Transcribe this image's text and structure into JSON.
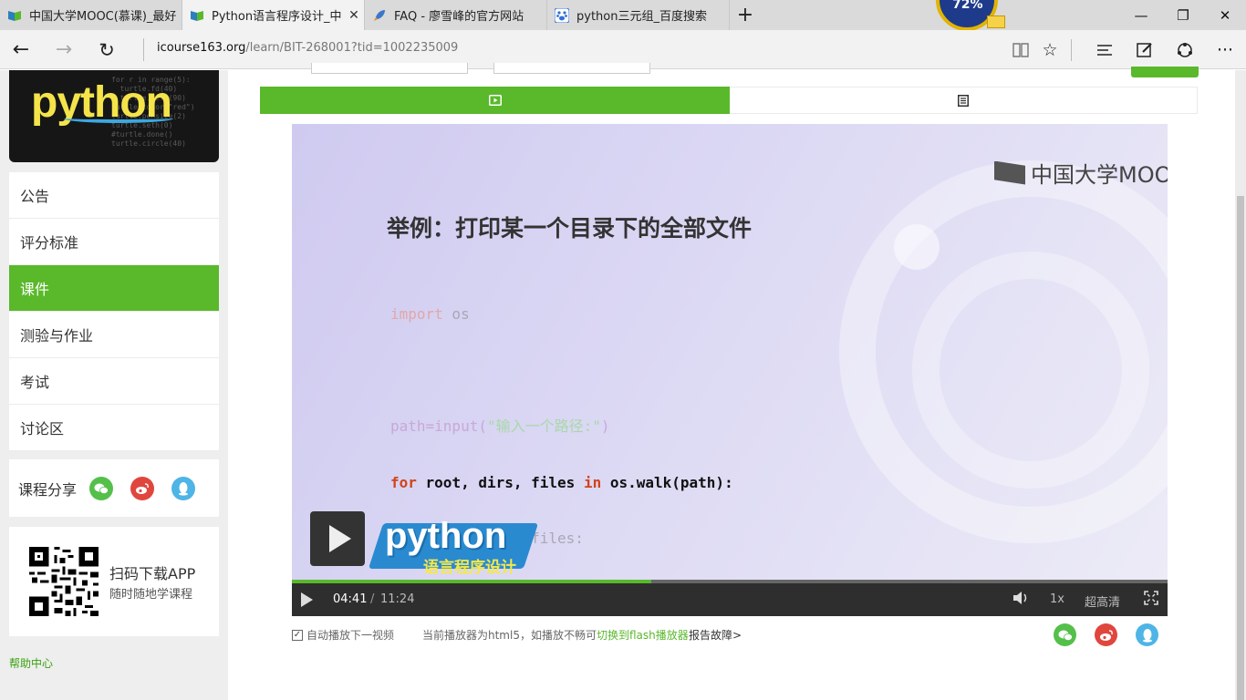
{
  "browser": {
    "tabs": [
      {
        "title": "中国大学MOOC(慕课)_最好",
        "active": false,
        "icon": "mooc-book-icon"
      },
      {
        "title": "Python语言程序设计_中",
        "active": true,
        "icon": "mooc-book-icon"
      },
      {
        "title": "FAQ - 廖雪峰的官方网站",
        "active": false,
        "icon": "rocket-icon"
      },
      {
        "title": "python三元组_百度搜索",
        "active": false,
        "icon": "baidu-paw-icon"
      }
    ],
    "new_tab": "+",
    "perf_meter": "72%",
    "url_host": "icourse163.org",
    "url_path": "/learn/BIT-268001?tid=1002235009"
  },
  "sidebar": {
    "menu": [
      {
        "label": "公告",
        "active": false
      },
      {
        "label": "评分标准",
        "active": false
      },
      {
        "label": "课件",
        "active": true
      },
      {
        "label": "测验与作业",
        "active": false
      },
      {
        "label": "考试",
        "active": false
      },
      {
        "label": "讨论区",
        "active": false
      }
    ],
    "share_label": "课程分享",
    "app_title": "扫码下载APP",
    "app_subtitle": "随时随地学课程",
    "help": "帮助中心"
  },
  "slide": {
    "brand": "中国大学MOOC",
    "title": "举例：打印某一个目录下的全部文件",
    "badge_logo": "python",
    "badge_text": "语言程序设计"
  },
  "player": {
    "current_time": "04:41",
    "separator": "/",
    "total_time": "11:24",
    "progress_fraction": 0.41,
    "speed": "1x",
    "quality": "超高清"
  },
  "below_player": {
    "autoplay_label": "自动播放下一视频",
    "notice_text": "当前播放器为html5，如播放不畅可",
    "switch_link": "切换到flash播放器",
    "report_link": "报告故障>"
  },
  "colors": {
    "accent_green": "#5ab82b",
    "wechat": "#54c04a",
    "weibo": "#e0463e",
    "qq": "#4fb4e6"
  }
}
